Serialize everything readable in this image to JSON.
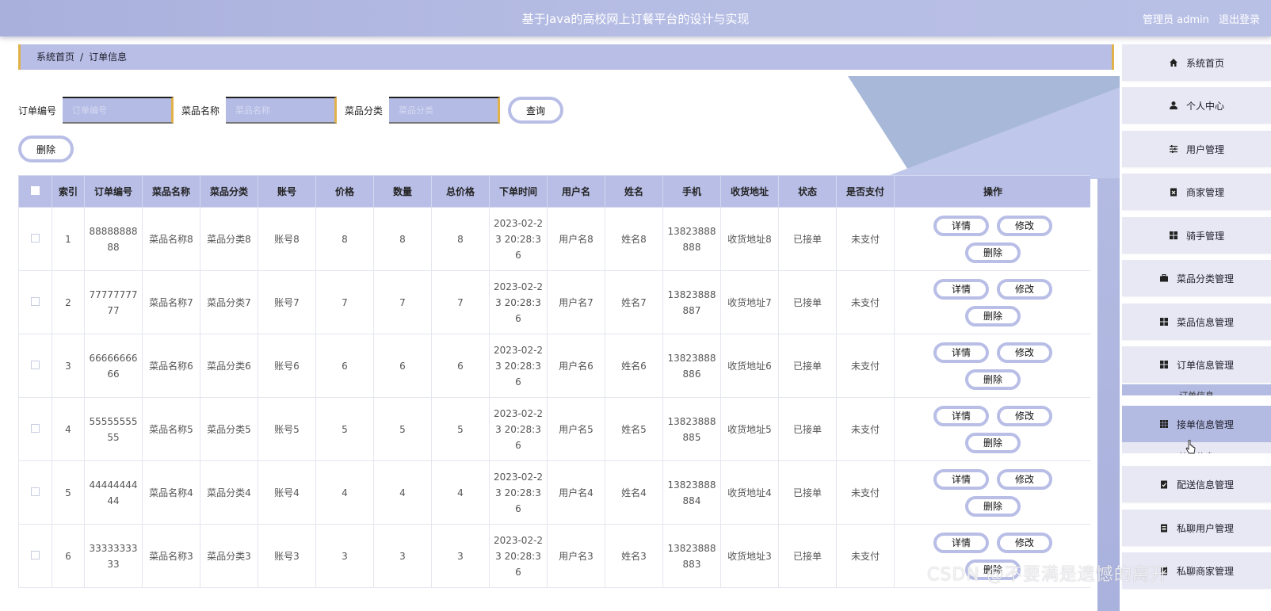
{
  "header": {
    "title": "基于Java的高校网上订餐平台的设计与实现",
    "user_label": "管理员 admin",
    "logout_label": "退出登录"
  },
  "breadcrumb": {
    "home": "系统首页",
    "separator": "/",
    "current": "订单信息"
  },
  "search": {
    "fields": [
      {
        "label": "订单编号",
        "placeholder": "订单编号"
      },
      {
        "label": "菜品名称",
        "placeholder": "菜品名称"
      },
      {
        "label": "菜品分类",
        "placeholder": "菜品分类"
      }
    ],
    "query_label": "查询"
  },
  "toolbar": {
    "delete_label": "删除"
  },
  "table": {
    "columns": [
      "索引",
      "订单编号",
      "菜品名称",
      "菜品分类",
      "账号",
      "价格",
      "数量",
      "总价格",
      "下单时间",
      "用户名",
      "姓名",
      "手机",
      "收货地址",
      "状态",
      "是否支付",
      "操作"
    ],
    "actions": {
      "detail": "详情",
      "edit": "修改",
      "delete": "删除"
    },
    "rows": [
      {
        "index": "1",
        "order_no": "8888888888",
        "dish_name": "菜品名称8",
        "dish_cat": "菜品分类8",
        "account": "账号8",
        "price": "8",
        "qty": "8",
        "total": "8",
        "time": "2023-02-23 20:28:36",
        "username": "用户名8",
        "name": "姓名8",
        "phone": "13823888888",
        "address": "收货地址8",
        "status": "已接单",
        "paid": "未支付"
      },
      {
        "index": "2",
        "order_no": "7777777777",
        "dish_name": "菜品名称7",
        "dish_cat": "菜品分类7",
        "account": "账号7",
        "price": "7",
        "qty": "7",
        "total": "7",
        "time": "2023-02-23 20:28:36",
        "username": "用户名7",
        "name": "姓名7",
        "phone": "13823888887",
        "address": "收货地址7",
        "status": "已接单",
        "paid": "未支付"
      },
      {
        "index": "3",
        "order_no": "6666666666",
        "dish_name": "菜品名称6",
        "dish_cat": "菜品分类6",
        "account": "账号6",
        "price": "6",
        "qty": "6",
        "total": "6",
        "time": "2023-02-23 20:28:36",
        "username": "用户名6",
        "name": "姓名6",
        "phone": "13823888886",
        "address": "收货地址6",
        "status": "已接单",
        "paid": "未支付"
      },
      {
        "index": "4",
        "order_no": "5555555555",
        "dish_name": "菜品名称5",
        "dish_cat": "菜品分类5",
        "account": "账号5",
        "price": "5",
        "qty": "5",
        "total": "5",
        "time": "2023-02-23 20:28:36",
        "username": "用户名5",
        "name": "姓名5",
        "phone": "13823888885",
        "address": "收货地址5",
        "status": "已接单",
        "paid": "未支付"
      },
      {
        "index": "5",
        "order_no": "4444444444",
        "dish_name": "菜品名称4",
        "dish_cat": "菜品分类4",
        "account": "账号4",
        "price": "4",
        "qty": "4",
        "total": "4",
        "time": "2023-02-23 20:28:36",
        "username": "用户名4",
        "name": "姓名4",
        "phone": "13823888884",
        "address": "收货地址4",
        "status": "已接单",
        "paid": "未支付"
      },
      {
        "index": "6",
        "order_no": "3333333333",
        "dish_name": "菜品名称3",
        "dish_cat": "菜品分类3",
        "account": "账号3",
        "price": "3",
        "qty": "3",
        "total": "3",
        "time": "2023-02-23 20:28:36",
        "username": "用户名3",
        "name": "姓名3",
        "phone": "13823888883",
        "address": "收货地址3",
        "status": "已接单",
        "paid": "未支付"
      }
    ]
  },
  "sidebar": {
    "items": [
      {
        "label": "系统首页",
        "icon": "home-icon"
      },
      {
        "label": "个人中心",
        "icon": "user-icon"
      },
      {
        "label": "用户管理",
        "icon": "sliders-icon"
      },
      {
        "label": "商家管理",
        "icon": "clipboard-x-icon"
      },
      {
        "label": "骑手管理",
        "icon": "grid-icon"
      },
      {
        "label": "菜品分类管理",
        "icon": "briefcase-icon"
      },
      {
        "label": "菜品信息管理",
        "icon": "grid-icon"
      },
      {
        "label": "订单信息管理",
        "icon": "grid-icon"
      },
      {
        "label": "接单信息管理",
        "icon": "grid-9-icon"
      },
      {
        "label": "配送信息管理",
        "icon": "clipboard-check-icon"
      },
      {
        "label": "私聊用户管理",
        "icon": "clipboard-icon"
      },
      {
        "label": "私聊商家管理",
        "icon": "check-icon"
      }
    ],
    "submenu_peek_1": "订单信息",
    "submenu_peek_2": "接单信息"
  },
  "watermark": "CSDN @不要满是遗憾的离开",
  "colors": {
    "accent": "#b8bee6",
    "accent_border": "#e2b24a",
    "header": "#b6bde4"
  }
}
